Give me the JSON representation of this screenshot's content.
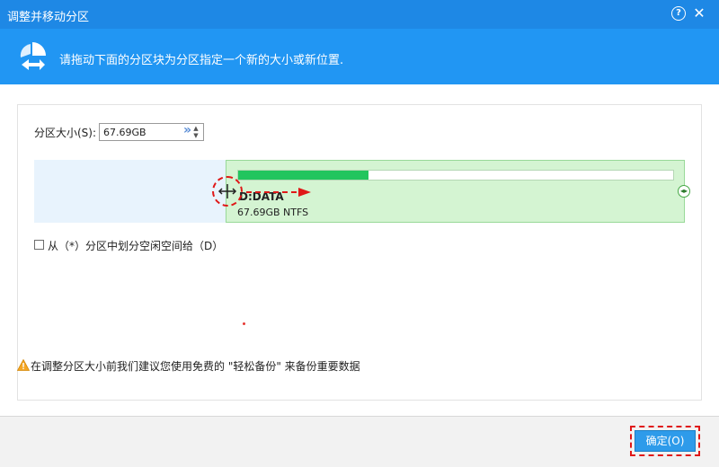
{
  "window": {
    "title": "调整并移动分区",
    "help_label": "?",
    "close_label": "✕"
  },
  "banner": {
    "text": "请拖动下面的分区块为分区指定一个新的大小或新位置."
  },
  "size": {
    "label": "分区大小(S):",
    "value": "67.69GB",
    "expand_label": "»"
  },
  "partition": {
    "name": "D:DATA",
    "size": "67.69GB NTFS",
    "used_fraction": 0.3
  },
  "option": {
    "label": "从（*）分区中划分空闲空间给（D）",
    "checked": false
  },
  "warning": {
    "text": "在调整分区大小前我们建议您使用免费的 \"轻松备份\" 来备份重要数据"
  },
  "footer": {
    "ok_label": "确定(O)"
  },
  "colors": {
    "titlebar": "#1e88e5",
    "banner": "#2196f3",
    "free_space": "#e8f3fd",
    "partition": "#d4f4d2",
    "usage": "#22c55e",
    "highlight": "#e01818",
    "ok_button": "#2e9bea"
  },
  "icons": {
    "banner": "move-resize-icon",
    "left_handle": "resize-arrows-icon",
    "right_handle": "resize-handle-icon",
    "warning": "warning-triangle-icon"
  }
}
